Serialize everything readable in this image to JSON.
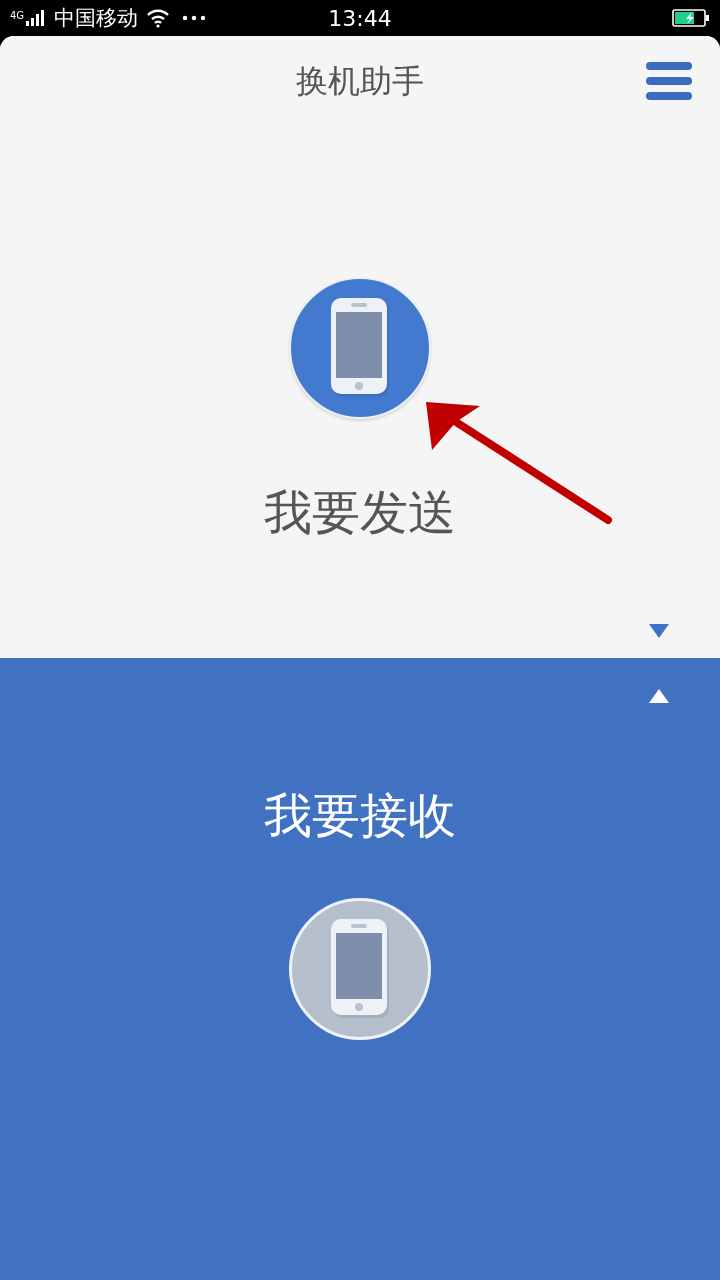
{
  "status_bar": {
    "network": "4G",
    "carrier": "中国移动",
    "time": "13:44"
  },
  "header": {
    "title": "换机助手"
  },
  "options": [
    {
      "label": "我要发送",
      "selected": true,
      "kind": "collapse"
    },
    {
      "label": "我要接收",
      "selected": false,
      "kind": "expand"
    }
  ],
  "annotation": {
    "kind": "arrow"
  }
}
